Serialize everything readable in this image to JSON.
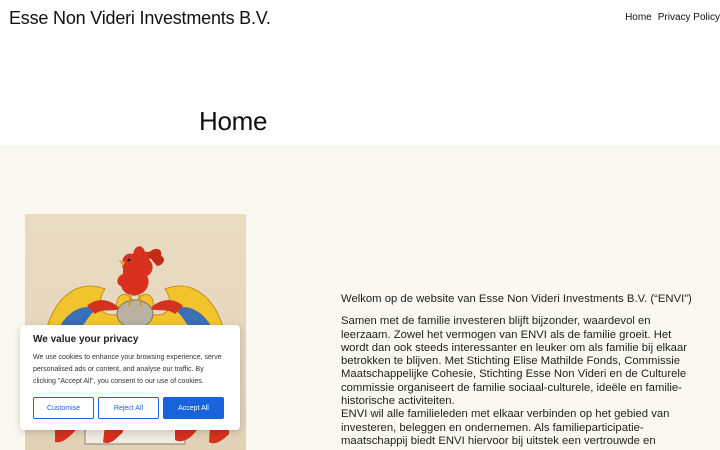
{
  "header": {
    "site_title": "Esse Non Videri Investments B.V.",
    "nav": [
      "Home",
      "Privacy Policy"
    ]
  },
  "page": {
    "title": "Home"
  },
  "content": {
    "intro": "Welkom op de website van Esse Non Videri Investments B.V. (“ENVI”)",
    "paragraphs": [
      "Samen met de familie investeren blijft bijzonder, waardevol en leerzaam. Zowel het vermogen van ENVI als de familie groeit. Het wordt dan ook steeds interessanter en leuker om als familie bij elkaar betrokken te blijven. Met Stichting Elise Mathilde Fonds, Commissie Maatschappelijke Cohesie, Stichting Esse Non Videri en de Culturele commissie organiseert de familie sociaal-culturele, ideële en familie-historische activiteiten.",
      "ENVI wil alle familieleden met elkaar verbinden op het gebied van investeren, beleggen en ondernemen. Als familieparticipatie-maatschappij biedt ENVI hiervoor bij uitstek een vertrouwde en"
    ]
  },
  "cookie_banner": {
    "title": "We value your privacy",
    "text": "We use cookies to enhance your browsing experience, serve personalised ads or content, and analyse our traffic. By clicking \"Accept All\", you consent to our use of cookies.",
    "buttons": [
      "Customise",
      "Reject All",
      "Accept All"
    ],
    "accent_color": "#1863dc"
  },
  "colors": {
    "content_bg": "#f9f9f1"
  }
}
